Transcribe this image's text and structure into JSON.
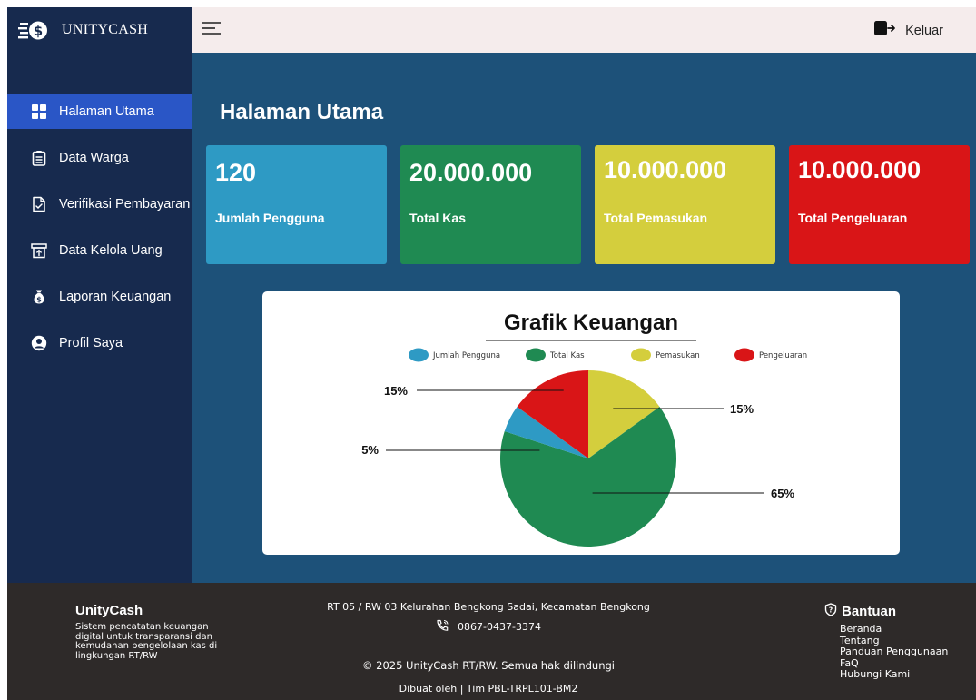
{
  "brand": {
    "name": "UNITYCASH",
    "logo_icon": "money-stack-icon"
  },
  "topbar": {
    "menu_icon": "hamburger-icon",
    "logout_label": "Keluar",
    "logout_icon": "logout-icon"
  },
  "sidebar": {
    "items": [
      {
        "label": "Halaman Utama",
        "icon": "dashboard-grid-icon",
        "active": true
      },
      {
        "label": "Data Warga",
        "icon": "clipboard-icon",
        "active": false
      },
      {
        "label": "Verifikasi Pembayaran",
        "icon": "document-check-icon",
        "active": false
      },
      {
        "label": "Data Kelola Uang",
        "icon": "cash-drawer-icon",
        "active": false
      },
      {
        "label": "Laporan Keuangan",
        "icon": "money-bag-icon",
        "active": false
      },
      {
        "label": "Profil Saya",
        "icon": "user-circle-icon",
        "active": false
      }
    ]
  },
  "main": {
    "title": "Halaman Utama",
    "cards": [
      {
        "value": "120",
        "label": "Jumlah Pengguna",
        "color": "#2e9ac4"
      },
      {
        "value": "20.000.000",
        "label": "Total Kas",
        "color": "#1f8a52"
      },
      {
        "value": "10.000.000",
        "label": "Total Pemasukan",
        "color": "#d4ce3d"
      },
      {
        "value": "10.000.000",
        "label": "Total Pengeluaran",
        "color": "#d91517"
      }
    ]
  },
  "chart_data": {
    "type": "pie",
    "title": "Grafik Keuangan",
    "legend_position": "top",
    "slices": [
      {
        "name": "Jumlah Pengguna",
        "value": 5,
        "label": "5%",
        "color": "#2e9ac4"
      },
      {
        "name": "Total Kas",
        "value": 65,
        "label": "65%",
        "color": "#1f8a52"
      },
      {
        "name": "Pemasukan",
        "value": 15,
        "label": "15%",
        "color": "#d4ce3d"
      },
      {
        "name": "Pengeluaran",
        "value": 15,
        "label": "15%",
        "color": "#d91517"
      }
    ]
  },
  "footer": {
    "brand": "UnityCash",
    "description": "Sistem pencatatan keuangan digital untuk transparansi dan kemudahan pengelolaan kas di lingkungan RT/RW",
    "address": "RT 05 / RW 03 Kelurahan Bengkong Sadai, Kecamatan Bengkong",
    "phone": "0867-0437-3374",
    "phone_icon": "phone-icon",
    "copyright": "© 2025 UnityCash RT/RW. Semua hak dilindungi",
    "made_by": "Dibuat oleh | Tim PBL-TRPL101-BM2",
    "help": {
      "title": "Bantuan",
      "icon": "shield-question-icon",
      "links": [
        "Beranda",
        "Tentang",
        "Panduan Penggunaan",
        "FaQ",
        "Hubungi Kami"
      ]
    }
  }
}
